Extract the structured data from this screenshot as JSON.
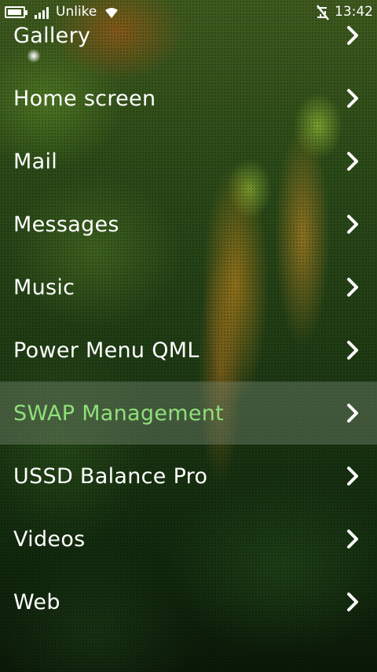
{
  "status_bar": {
    "operator": "Unlike",
    "time": "13:42",
    "icons": [
      "battery-icon",
      "signal-strength-icon",
      "wifi-icon",
      "no-sim-icon"
    ]
  },
  "menu": {
    "items": [
      {
        "label": "Gallery",
        "icon": "chevron-right-icon"
      },
      {
        "label": "Home screen",
        "icon": "chevron-right-icon"
      },
      {
        "label": "Mail",
        "icon": "chevron-right-icon"
      },
      {
        "label": "Messages",
        "icon": "chevron-right-icon"
      },
      {
        "label": "Music",
        "icon": "chevron-right-icon"
      },
      {
        "label": "Power Menu QML",
        "icon": "chevron-right-icon"
      },
      {
        "label": "SWAP Management",
        "icon": "chevron-right-icon",
        "selected": true
      },
      {
        "label": "USSD Balance Pro",
        "icon": "chevron-right-icon"
      },
      {
        "label": "Videos",
        "icon": "chevron-right-icon"
      },
      {
        "label": "Web",
        "icon": "chevron-right-icon"
      }
    ]
  },
  "colors": {
    "text": "#ffffff",
    "selected_text": "#8fe07a",
    "selected_background": "#78877390"
  }
}
